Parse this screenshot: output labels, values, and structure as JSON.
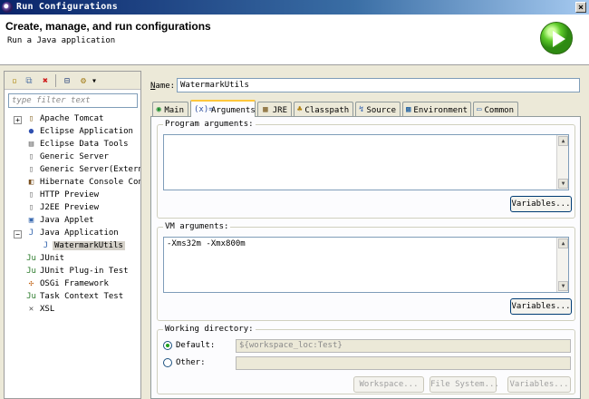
{
  "window": {
    "title": "Run Configurations",
    "close_glyph": "×"
  },
  "header": {
    "title": "Create, manage, and run configurations",
    "subtitle": "Run a Java application",
    "icon": "run-icon"
  },
  "left_panel": {
    "toolbar": [
      {
        "name": "new-config",
        "glyph": "▫"
      },
      {
        "name": "duplicate",
        "glyph": "⧉"
      },
      {
        "name": "delete",
        "glyph": "✖"
      },
      {
        "name": "collapse-all",
        "glyph": "⊟"
      },
      {
        "name": "filter",
        "glyph": "⚙"
      },
      {
        "name": "dropdown",
        "glyph": "▾"
      }
    ],
    "filter_placeholder": "type filter text",
    "tree": [
      {
        "label": "Apache Tomcat",
        "level": 0,
        "expander": "+",
        "icon": "tomcat-icon",
        "glyph": "▯"
      },
      {
        "label": "Eclipse Application",
        "level": 0,
        "expander": "",
        "icon": "eclipse-icon",
        "glyph": "●"
      },
      {
        "label": "Eclipse Data Tools",
        "level": 0,
        "expander": "",
        "icon": "database-icon",
        "glyph": "▤"
      },
      {
        "label": "Generic Server",
        "level": 0,
        "expander": "",
        "icon": "server-icon",
        "glyph": "▯"
      },
      {
        "label": "Generic Server(Externa",
        "level": 0,
        "expander": "",
        "icon": "server-icon",
        "glyph": "▯"
      },
      {
        "label": "Hibernate Console Confi",
        "level": 0,
        "expander": "",
        "icon": "hibernate-icon",
        "glyph": "◧"
      },
      {
        "label": "HTTP Preview",
        "level": 0,
        "expander": "",
        "icon": "server-icon",
        "glyph": "▯"
      },
      {
        "label": "J2EE Preview",
        "level": 0,
        "expander": "",
        "icon": "server-icon",
        "glyph": "▯"
      },
      {
        "label": "Java Applet",
        "level": 0,
        "expander": "",
        "icon": "applet-icon",
        "glyph": "▣"
      },
      {
        "label": "Java Application",
        "level": 0,
        "expander": "−",
        "icon": "java-app-icon",
        "glyph": "J"
      },
      {
        "label": "WatermarkUtils",
        "level": 1,
        "expander": "",
        "icon": "java-app-icon",
        "glyph": "J",
        "selected": true
      },
      {
        "label": "JUnit",
        "level": 0,
        "expander": "",
        "icon": "junit-icon",
        "glyph": "Ju"
      },
      {
        "label": "JUnit Plug-in Test",
        "level": 0,
        "expander": "",
        "icon": "junit-plugin-icon",
        "glyph": "Ju"
      },
      {
        "label": "OSGi Framework",
        "level": 0,
        "expander": "",
        "icon": "osgi-icon",
        "glyph": "✣"
      },
      {
        "label": "Task Context Test",
        "level": 0,
        "expander": "",
        "icon": "task-context-icon",
        "glyph": "Ju"
      },
      {
        "label": "XSL",
        "level": 0,
        "expander": "",
        "icon": "xsl-icon",
        "glyph": "✕"
      }
    ]
  },
  "config": {
    "name_label": "Name:",
    "name_value": "WatermarkUtils",
    "tabs": [
      {
        "label": "Main",
        "icon": "main-tab-icon",
        "glyph": "◉",
        "color": "#1a8a2a"
      },
      {
        "label": "Arguments",
        "icon": "arguments-tab-icon",
        "glyph": "(x)=",
        "color": "#3050a0",
        "active": true
      },
      {
        "label": "JRE",
        "icon": "jre-tab-icon",
        "glyph": "▦",
        "color": "#7a5a20"
      },
      {
        "label": "Classpath",
        "icon": "classpath-tab-icon",
        "glyph": "♣",
        "color": "#b08010"
      },
      {
        "label": "Source",
        "icon": "source-tab-icon",
        "glyph": "↯",
        "color": "#3060b0"
      },
      {
        "label": "Environment",
        "icon": "environment-tab-icon",
        "glyph": "▩",
        "color": "#2060a0"
      },
      {
        "label": "Common",
        "icon": "common-tab-icon",
        "glyph": "▭",
        "color": "#4070b0"
      }
    ],
    "program_args": {
      "legend": "Program arguments:",
      "value": "",
      "variables_button": "Variables..."
    },
    "vm_args": {
      "legend": "VM arguments:",
      "value": "-Xms32m -Xmx800m",
      "variables_button": "Variables..."
    },
    "working_dir": {
      "legend": "Working directory:",
      "default_label": "Default:",
      "default_value": "${workspace_loc:Test}",
      "other_label": "Other:",
      "other_value": "",
      "workspace_button": "Workspace...",
      "filesystem_button": "File System...",
      "variables_button": "Variables..."
    }
  }
}
